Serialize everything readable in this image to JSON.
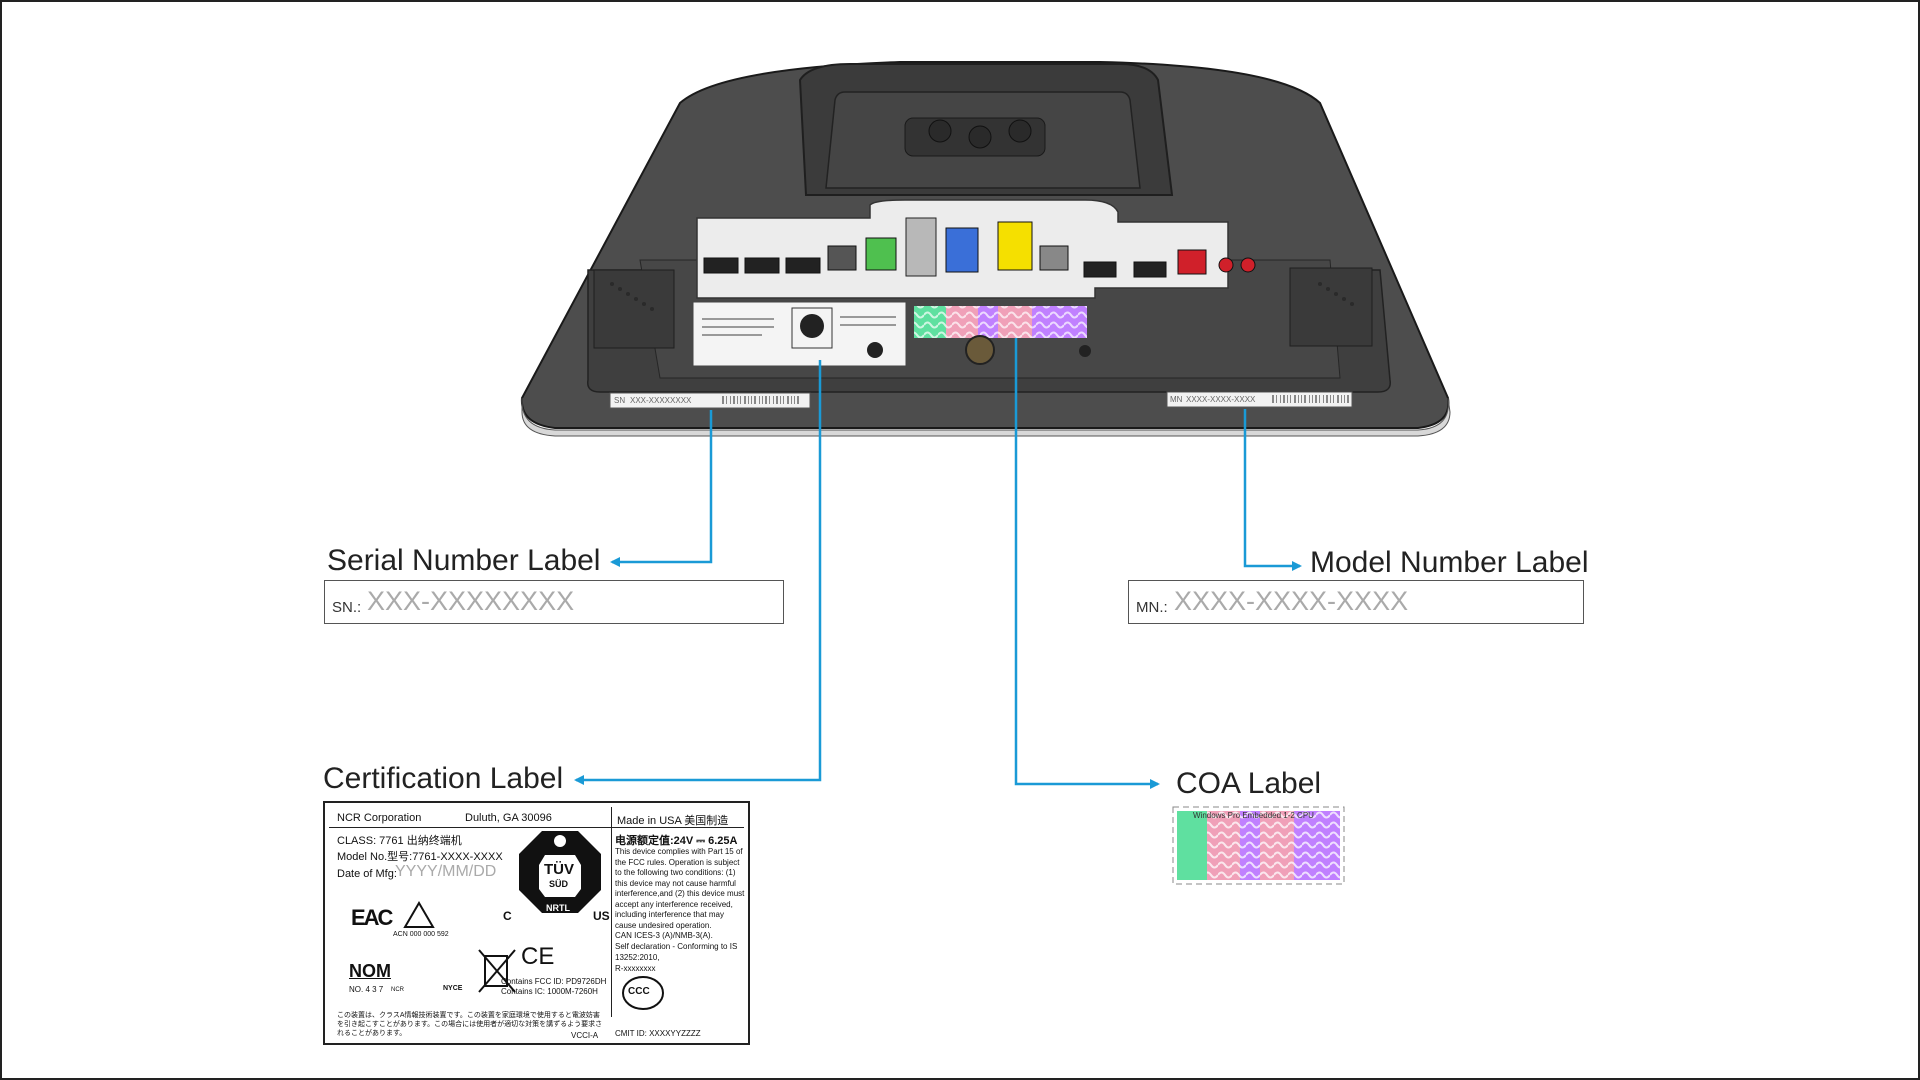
{
  "callouts": {
    "serial": {
      "title": "Serial Number Label",
      "prefix": "SN.:",
      "value": "XXX-XXXXXXXX"
    },
    "model": {
      "title": "Model Number Label",
      "prefix": "MN.:",
      "value": "XXXX-XXXX-XXXX"
    },
    "certification": {
      "title": "Certification Label"
    },
    "coa": {
      "title": "COA Label",
      "strip_text": "Windows Pro Embedded 1-2 CPU"
    }
  },
  "device_labels": {
    "serial_mini": "XXX-XXXXXXXX",
    "serial_mini_prefix": "SN",
    "model_mini": "XXXX-XXXX-XXXX",
    "model_mini_prefix": "MN"
  },
  "cert_label": {
    "company": "NCR Corporation",
    "location": "Duluth, GA  30096",
    "made_in": "Made in USA  美国制造",
    "class": "CLASS: 7761  出纳终端机",
    "model_no": "Model No.型号:7761-XXXX-XXXX",
    "date_label": "Date of Mfg:",
    "date_value": "YYYY/MM/DD",
    "power": "电源额定值:24V ⎓ 6.25A",
    "fcc_text": "This device complies with Part 15 of the FCC rules. Operation is subject to the following two conditions: (1) this device may not cause harmful interference,and (2) this device must accept any interference received, including interference that may cause undesired operation.",
    "can_ices": "CAN ICES-3 (A)/NMB-3(A).",
    "self_decl": "Self declaration - Conforming to IS 13252:2010,",
    "r_number": "R-xxxxxxxx",
    "tuv": "TÜV",
    "sud": "SÜD",
    "nrtl": "NRTL",
    "c_mark": "C",
    "us_mark": "US",
    "acn": "ACN 000 000 592",
    "nom": "NOM",
    "nom_no": "NO. 4 3 7",
    "nom_suffix": "NCR",
    "nyce": "NYCE",
    "fcc_id": "Contains FCC ID: PD9726DH",
    "ic_id": "Contains IC: 1000M-7260H",
    "japanese": "この装置は、クラスA情報技術装置です。この装置を家庭環境で使用すると電波妨害を引き起こすことがあります。この場合には使用者が適切な対策を講ずるよう要求されることがあります。",
    "vcci": "VCCI-A",
    "cmit": "CMIT ID: XXXXYYZZZZ",
    "ccc": "CCC",
    "eac": "EAC",
    "ce": "CE"
  },
  "colors": {
    "arrow": "#1a9ad6",
    "device_body": "#4a4a4a",
    "device_dark": "#2e2e2e",
    "coa_green": "#5fe0a0",
    "coa_pink": "#f0a0b8",
    "coa_purple": "#c080ff",
    "usb_blue": "#3a6fd8",
    "port_yellow": "#f5e000",
    "port_green": "#4fc04f",
    "port_red": "#d0202a"
  }
}
